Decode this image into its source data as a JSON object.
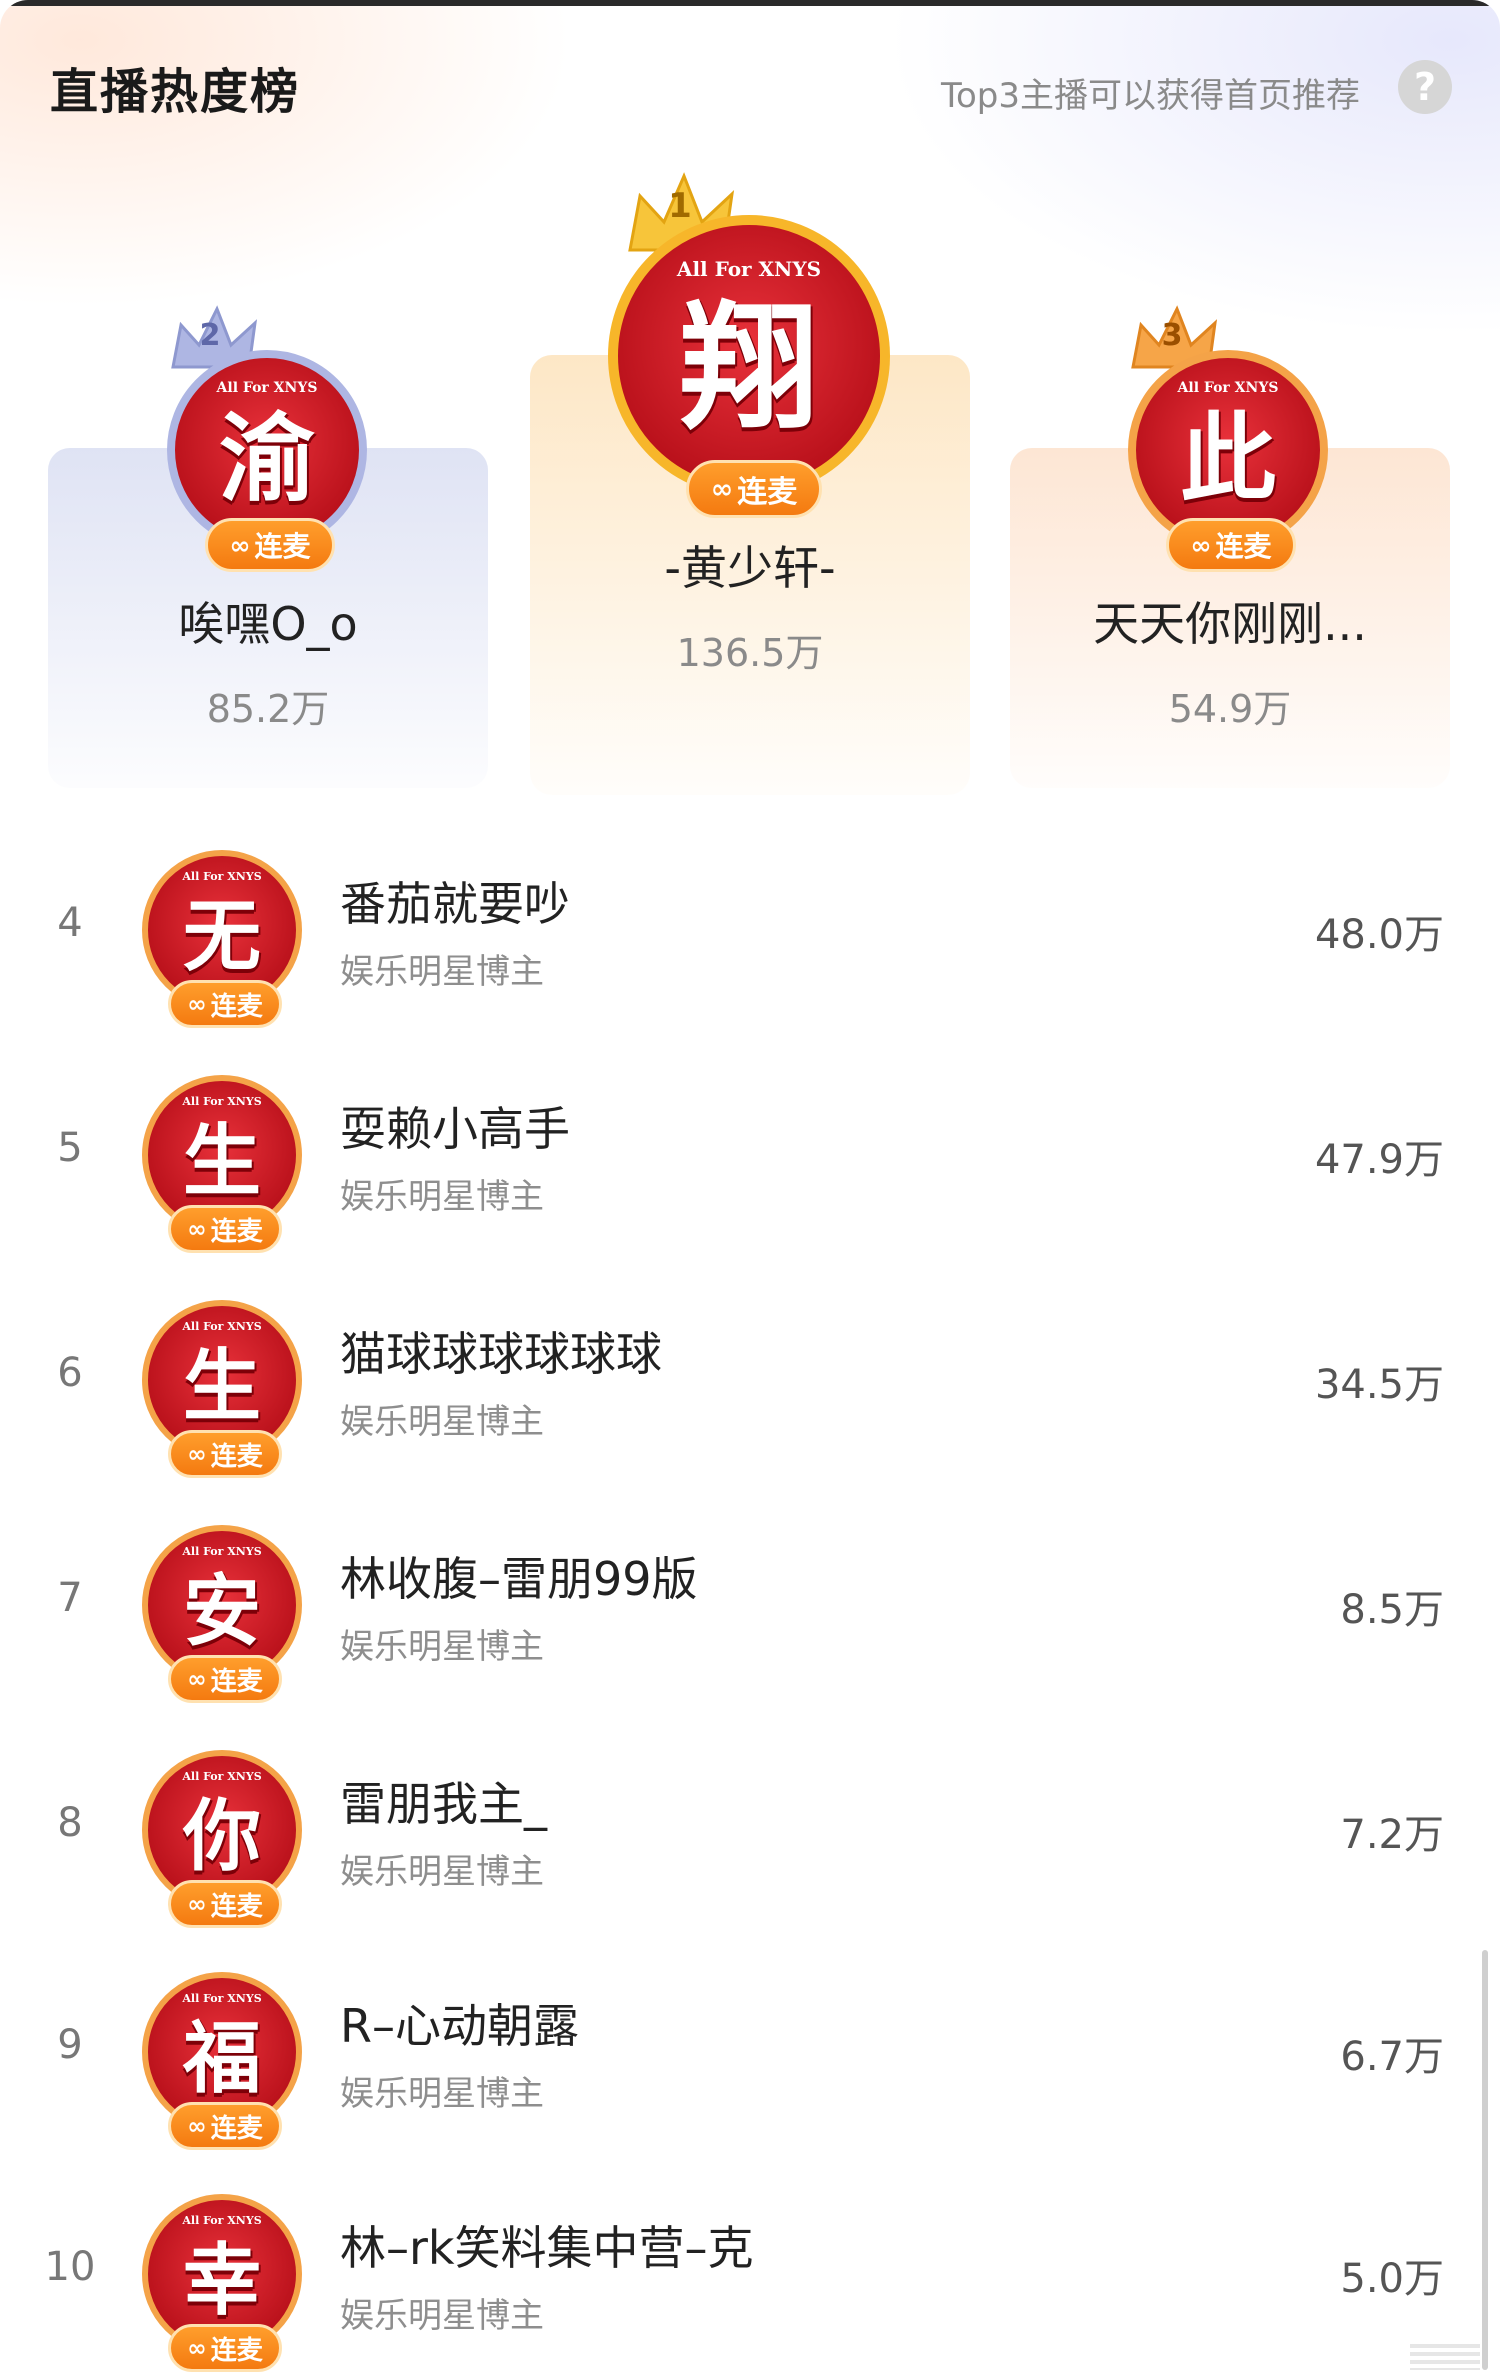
{
  "header": {
    "title": "直播热度榜",
    "subtitle": "Top3主播可以获得首页推荐",
    "help_icon": "?"
  },
  "podium": [
    {
      "rank": "2",
      "name": "唉嘿O_o",
      "score": "85.2万",
      "badge": "连麦",
      "avatar_glyph": "渝",
      "avatar_tag": "All For XNYS",
      "ring_color": "#aeb6e3"
    },
    {
      "rank": "1",
      "name": "-黄少轩-",
      "score": "136.5万",
      "badge": "连麦",
      "avatar_glyph": "翔",
      "avatar_tag": "All For XNYS",
      "ring_color": "#f7b62a"
    },
    {
      "rank": "3",
      "name": "天天你刚刚...",
      "score": "54.9万",
      "badge": "连麦",
      "avatar_glyph": "此",
      "avatar_tag": "All For XNYS",
      "ring_color": "#f4a348"
    }
  ],
  "list": [
    {
      "rank": "4",
      "name": "番茄就要吵",
      "category": "娱乐明星博主",
      "score": "48.0万",
      "badge": "连麦",
      "avatar_glyph": "无",
      "avatar_tag": "All For XNYS"
    },
    {
      "rank": "5",
      "name": "耍赖小高手",
      "category": "娱乐明星博主",
      "score": "47.9万",
      "badge": "连麦",
      "avatar_glyph": "生",
      "avatar_tag": "All For XNYS"
    },
    {
      "rank": "6",
      "name": "猫球球球球球球",
      "category": "娱乐明星博主",
      "score": "34.5万",
      "badge": "连麦",
      "avatar_glyph": "生",
      "avatar_tag": "All For XNYS"
    },
    {
      "rank": "7",
      "name": "林收腹–雷朋99版",
      "category": "娱乐明星博主",
      "score": "8.5万",
      "badge": "连麦",
      "avatar_glyph": "安",
      "avatar_tag": "All For XNYS"
    },
    {
      "rank": "8",
      "name": "雷朋我主_",
      "category": "娱乐明星博主",
      "score": "7.2万",
      "badge": "连麦",
      "avatar_glyph": "你",
      "avatar_tag": "All For XNYS"
    },
    {
      "rank": "9",
      "name": "R–心动朝露",
      "category": "娱乐明星博主",
      "score": "6.7万",
      "badge": "连麦",
      "avatar_glyph": "福",
      "avatar_tag": "All For XNYS"
    },
    {
      "rank": "10",
      "name": "林–rk笑料集中营–克",
      "category": "娱乐明星博主",
      "score": "5.0万",
      "badge": "连麦",
      "avatar_glyph": "幸",
      "avatar_tag": "All For XNYS"
    }
  ],
  "icons": {
    "help": "help-icon",
    "crown": "crown-icon",
    "link": "infinity-link-icon"
  },
  "colors": {
    "badge": "#f58a1c",
    "avatar_red": "#d0202a",
    "gold": "#f7b62a",
    "silver": "#aeb6e3",
    "bronze": "#f4a348"
  }
}
